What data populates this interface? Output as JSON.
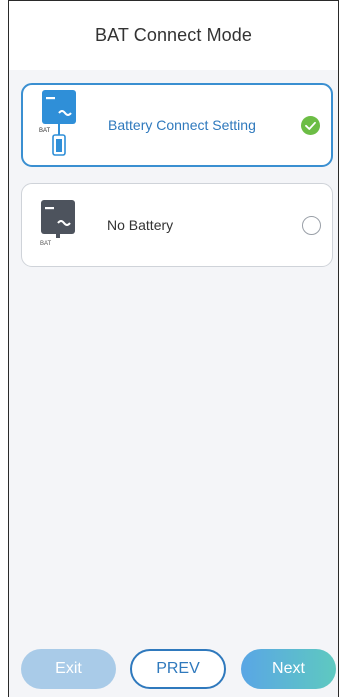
{
  "header": {
    "title": "BAT Connect Mode"
  },
  "options": [
    {
      "label": "Battery Connect Setting",
      "icon": "inverter-with-battery-icon",
      "icon_text": "BAT",
      "selected": true
    },
    {
      "label": "No Battery",
      "icon": "inverter-no-battery-icon",
      "icon_text": "BAT",
      "selected": false
    }
  ],
  "footer": {
    "exit_label": "Exit",
    "prev_label": "PREV",
    "next_label": "Next"
  },
  "colors": {
    "accent": "#2f79bd",
    "check": "#6cbd45",
    "disabled": "#a9cbe8"
  }
}
